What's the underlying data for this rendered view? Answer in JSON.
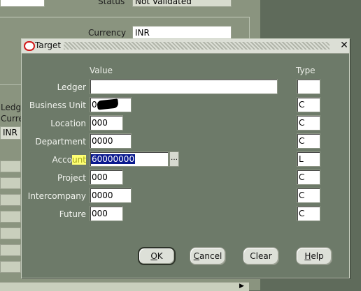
{
  "background": {
    "status_label": "Status",
    "status_value": "Not Validated",
    "currency_label": "Currency",
    "currency_value": "INR",
    "ledger_partial": "Ledg",
    "currency_partial": "Curre",
    "inr_partial": "INR"
  },
  "dialog": {
    "title": "Target",
    "close_glyph": "✕",
    "value_header": "Value",
    "type_header": "Type",
    "rows": [
      {
        "label": "Ledger",
        "value": "",
        "type": ""
      },
      {
        "label": "Business Unit",
        "value": "0",
        "type": "C"
      },
      {
        "label": "Location",
        "value": "000",
        "type": "C"
      },
      {
        "label": "Department",
        "value": "0000",
        "type": "C"
      },
      {
        "label_plain": "Acco",
        "label_highlight": "unt",
        "value": "60000000",
        "type": "L"
      },
      {
        "label": "Project",
        "value": "000",
        "type": "C"
      },
      {
        "label": "Intercompany",
        "value": "0000",
        "type": "C"
      },
      {
        "label": "Future",
        "value": "000",
        "type": "C"
      }
    ],
    "lov_glyph": "…",
    "buttons": {
      "ok_mnemonic": "O",
      "ok_rest": "K",
      "cancel_mnemonic": "C",
      "cancel_rest": "ancel",
      "clear": "Clear",
      "help_mnemonic": "H",
      "help_rest": "elp"
    }
  },
  "colors": {
    "highlight": "#ffff74",
    "selection": "#0b1a8f",
    "title_icon": "#d31a1a"
  },
  "icons": [
    "oracle-icon",
    "close-icon",
    "list-of-values-icon"
  ]
}
